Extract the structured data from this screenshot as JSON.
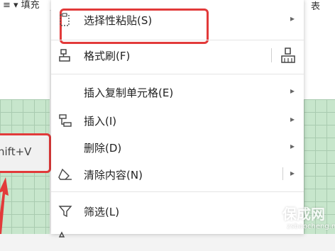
{
  "toolbar": {
    "left_text": "≡ ▾ 填充",
    "right_text": "表"
  },
  "shortcut_hint": {
    "text": "hift+V"
  },
  "context_menu": {
    "items": [
      {
        "label": "选择性粘贴(S)",
        "icon": "paste-special-icon",
        "submenu": true
      },
      {
        "label": "格式刷(F)",
        "icon": "format-brush-icon",
        "submenu": false
      },
      {
        "label": "插入复制单元格(E)",
        "icon": "",
        "submenu": true
      },
      {
        "label": "插入(I)",
        "icon": "insert-icon",
        "submenu": true
      },
      {
        "label": "删除(D)",
        "icon": "",
        "submenu": true
      },
      {
        "label": "清除内容(N)",
        "icon": "eraser-icon",
        "submenu": true
      },
      {
        "label": "筛选(L)",
        "icon": "filter-icon",
        "submenu": false
      }
    ]
  },
  "watermark": {
    "text": "保成网",
    "sub": "zsbaocheng.net"
  },
  "colors": {
    "highlight": "#e23a3a",
    "grid_fill": "#c7e6cc"
  }
}
